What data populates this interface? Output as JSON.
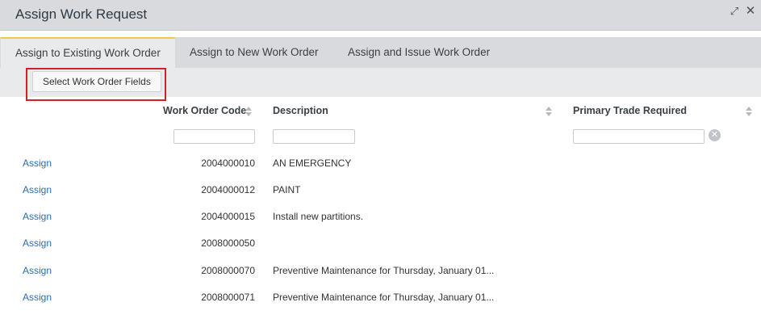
{
  "dialog": {
    "title": "Assign Work Request",
    "icons": {
      "maximize": "maximize-icon",
      "close": "close-icon"
    }
  },
  "tabs": [
    {
      "label": "Assign to Existing Work Order",
      "active": true
    },
    {
      "label": "Assign to New Work Order",
      "active": false
    },
    {
      "label": "Assign and Issue Work Order",
      "active": false
    }
  ],
  "toolbar": {
    "select_fields_label": "Select Work Order Fields"
  },
  "columns": {
    "code": "Work Order Code",
    "description": "Description",
    "trade": "Primary Trade Required"
  },
  "filters": {
    "code": "",
    "description": "",
    "trade": ""
  },
  "rows": [
    {
      "action": "Assign",
      "code": "2004000010",
      "description": "AN EMERGENCY",
      "trade": ""
    },
    {
      "action": "Assign",
      "code": "2004000012",
      "description": "PAINT",
      "trade": ""
    },
    {
      "action": "Assign",
      "code": "2004000015",
      "description": "Install new partitions.",
      "trade": ""
    },
    {
      "action": "Assign",
      "code": "2008000050",
      "description": "",
      "trade": ""
    },
    {
      "action": "Assign",
      "code": "2008000070",
      "description": "Preventive Maintenance for Thursday, January 01...",
      "trade": ""
    },
    {
      "action": "Assign",
      "code": "2008000071",
      "description": "Preventive Maintenance for Thursday, January 01...",
      "trade": ""
    }
  ],
  "colors": {
    "link": "#2b6cb0",
    "highlight": "#d0202a",
    "active_tab_accent": "#f2c94c"
  }
}
